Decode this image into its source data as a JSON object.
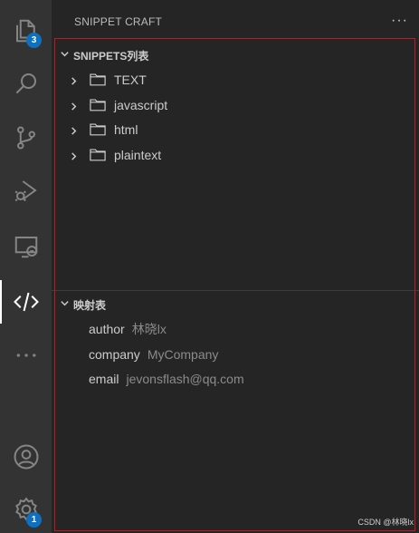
{
  "activitybar": {
    "items": [
      {
        "icon": "files-icon",
        "badge": "3"
      },
      {
        "icon": "search-icon"
      },
      {
        "icon": "source-control-icon"
      },
      {
        "icon": "run-debug-icon"
      },
      {
        "icon": "remote-explorer-icon"
      },
      {
        "icon": "code-icon",
        "active": true
      },
      {
        "icon": "more-icon"
      }
    ],
    "bottom": [
      {
        "icon": "account-icon"
      },
      {
        "icon": "settings-gear-icon",
        "badge": "1"
      }
    ]
  },
  "sidebar": {
    "title": "SNIPPET CRAFT",
    "more": "···"
  },
  "snippets_section": {
    "title": "SNIPPETS列表",
    "folders": [
      "TEXT",
      "javascript",
      "html",
      "plaintext"
    ]
  },
  "mapping_section": {
    "title": "映射表",
    "entries": [
      {
        "key": "author",
        "value": "林晓lx"
      },
      {
        "key": "company",
        "value": "MyCompany"
      },
      {
        "key": "email",
        "value": "jevonsflash@qq.com"
      }
    ]
  },
  "watermark": "CSDN @林晓lx",
  "colors": {
    "activitybar_bg": "#333333",
    "sidebar_bg": "#252526",
    "badge": "#0e70c0",
    "highlight_frame": "#c8161d"
  }
}
